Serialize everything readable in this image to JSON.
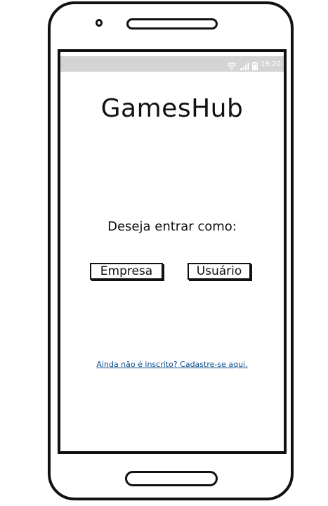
{
  "status_bar": {
    "time": "19:20",
    "icons": [
      "wifi-icon",
      "signal-icon",
      "battery-icon"
    ]
  },
  "app": {
    "title": "GamesHub"
  },
  "login": {
    "prompt": "Deseja entrar como:",
    "company_button_label": "Empresa",
    "user_button_label": "Usuário",
    "signup_link_text": "Ainda não é inscrito? Cadastre-se aqui."
  },
  "colors": {
    "status_bar_bg": "#d4d4d4",
    "link": "#0a4b8c",
    "ink": "#111111"
  }
}
